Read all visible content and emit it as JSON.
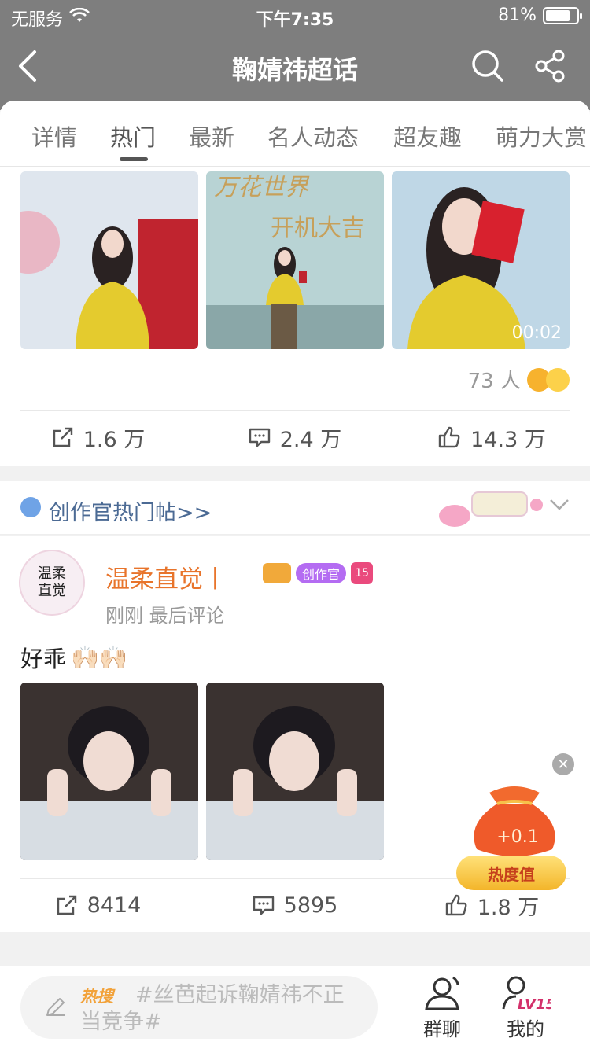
{
  "status_bar": {
    "carrier": "无服务",
    "time": "下午7:35",
    "battery": "81%",
    "battery_level": 0.81
  },
  "nav": {
    "title": "鞠婧祎超话"
  },
  "tabs": [
    {
      "label": "详情",
      "active": false
    },
    {
      "label": "热门",
      "active": true
    },
    {
      "label": "最新",
      "active": false
    },
    {
      "label": "名人动态",
      "active": false
    },
    {
      "label": "超友趣",
      "active": false
    },
    {
      "label": "萌力大赏",
      "active": false
    }
  ],
  "post1": {
    "images": [
      {
        "desc": "",
        "video_time": ""
      },
      {
        "desc": "",
        "banner_line1": "万花世界",
        "banner_line2": "开机大吉",
        "video_time": ""
      },
      {
        "desc": "",
        "video_time": "00:02"
      }
    ],
    "reaction_count": "73 人",
    "repost": "1.6 万",
    "comments": "2.4 万",
    "likes": "14.3 万"
  },
  "creator_bar": {
    "label": "创作官热门帖>>"
  },
  "post2": {
    "avatar_text_line1": "温柔",
    "avatar_text_line2": "直觉",
    "username": "温柔直觉丨",
    "badge_creator": "创作官",
    "badge_level": "15",
    "meta": "刚刚  最后评论",
    "text": "好乖",
    "emoji": "🙌🏻🙌🏻",
    "repost": "8414",
    "comments": "5895",
    "likes": "1.8 万"
  },
  "float_widget": {
    "plus": "+0.1",
    "label": "热度值",
    "close": "✕"
  },
  "bottom_bar": {
    "hot_tag": "热搜",
    "compose_text": "#丝芭起诉鞠婧祎不正当竞争#",
    "group_chat": "群聊",
    "mine": "我的",
    "mine_level": "LV15"
  },
  "colors": {
    "header": "#7e7e7e",
    "username": "#e8742b",
    "creator_label": "#4b6a94",
    "hot_tag": "#f2a23a"
  }
}
